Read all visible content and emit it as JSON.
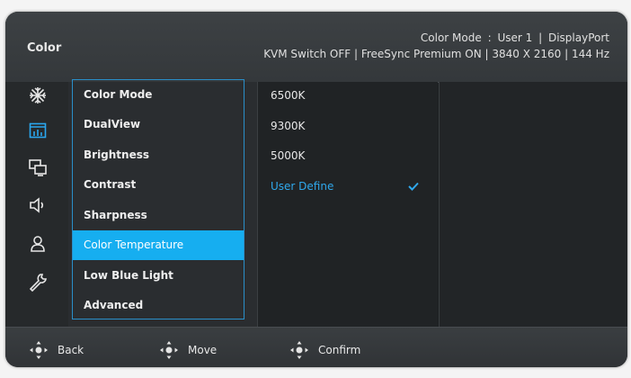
{
  "header": {
    "title": "Color",
    "status_line1": [
      "Color Mode",
      ":",
      "User 1",
      "|",
      "DisplayPort"
    ],
    "status_line2": "KVM Switch OFF | FreeSync Premium ON | 3840 X 2160 | 144 Hz"
  },
  "sidebar": {
    "icons": [
      "snowflake-icon",
      "color-bars-icon",
      "dual-screen-icon",
      "speaker-icon",
      "person-icon",
      "wrench-icon"
    ],
    "active_index": 1
  },
  "menu": {
    "items": [
      {
        "label": "Color Mode"
      },
      {
        "label": "DualView"
      },
      {
        "label": "Brightness"
      },
      {
        "label": "Contrast"
      },
      {
        "label": "Sharpness"
      },
      {
        "label": "Color Temperature",
        "active": true
      },
      {
        "label": "Low Blue Light"
      },
      {
        "label": "Advanced"
      }
    ]
  },
  "options": {
    "items": [
      {
        "label": "6500K"
      },
      {
        "label": "9300K"
      },
      {
        "label": "5000K"
      },
      {
        "label": "User Define",
        "selected": true
      }
    ]
  },
  "footer": {
    "back_label": "Back",
    "move_label": "Move",
    "confirm_label": "Confirm"
  },
  "colors": {
    "accent": "#16aef0",
    "selected_text": "#2fa8ec",
    "frame": "#2a8fc9"
  }
}
